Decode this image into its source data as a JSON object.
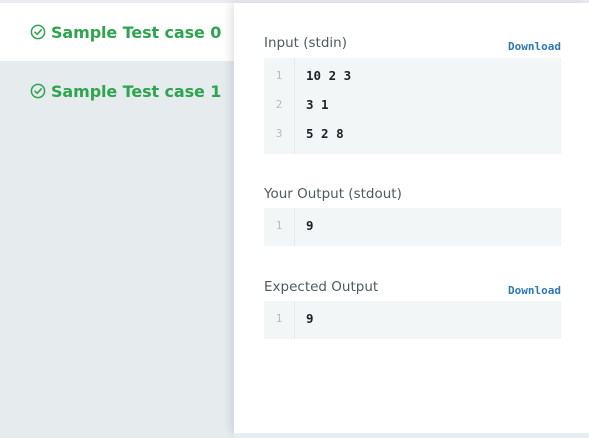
{
  "tabs": [
    {
      "label": "Sample Test case 0",
      "status_icon": "check-circle-icon",
      "active": true
    },
    {
      "label": "Sample Test case 1",
      "status_icon": "check-circle-icon",
      "active": false
    }
  ],
  "colors": {
    "pass": "#2ea44f",
    "link": "#2d79b8"
  },
  "input": {
    "title": "Input (stdin)",
    "download_label": "Download",
    "lines": [
      {
        "n": "1",
        "text": "10 2 3"
      },
      {
        "n": "2",
        "text": "3 1"
      },
      {
        "n": "3",
        "text": "5 2 8"
      }
    ]
  },
  "your_output": {
    "title": "Your Output (stdout)",
    "lines": [
      {
        "n": "1",
        "text": "9"
      }
    ]
  },
  "expected_output": {
    "title": "Expected Output",
    "download_label": "Download",
    "lines": [
      {
        "n": "1",
        "text": "9"
      }
    ]
  }
}
